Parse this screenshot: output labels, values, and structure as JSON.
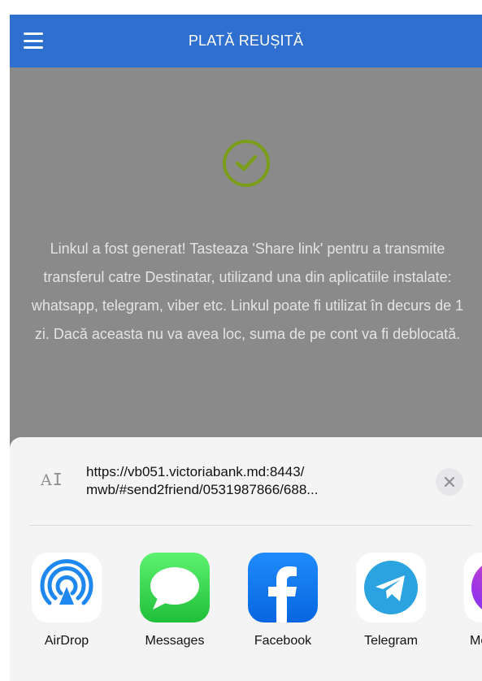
{
  "header": {
    "title": "PLATĂ REUȘITĂ",
    "menu_icon": "hamburger-menu-icon"
  },
  "status": {
    "icon": "check-circle-icon",
    "color": "#7a9e1a",
    "message": "Linkul a fost generat! Tasteaza 'Share link' pentru a transmite transferul catre Destinatar, utilizand una din aplicatiile instalate: whatsapp, telegram, viber etc. Linkul poate fi utilizat în decurs de 1 zi. Dacă aceasta nu va avea loc, suma de pe cont va fi deblocată."
  },
  "share_sheet": {
    "text_icon_glyph": "A",
    "url_line1": "https://vb051.victoriabank.md:8443/",
    "url_line2": "mwb/#send2friend/0531987866/688...",
    "apps": [
      {
        "label": "AirDrop",
        "icon": "airdrop-icon"
      },
      {
        "label": "Messages",
        "icon": "messages-icon"
      },
      {
        "label": "Facebook",
        "icon": "facebook-icon"
      },
      {
        "label": "Telegram",
        "icon": "telegram-icon"
      },
      {
        "label": "Me",
        "icon": "messenger-icon"
      }
    ]
  },
  "colors": {
    "header_bg": "#2f6fcf",
    "overlay_bg": "#8a8a8a",
    "sheet_bg": "#f4f4f5"
  }
}
